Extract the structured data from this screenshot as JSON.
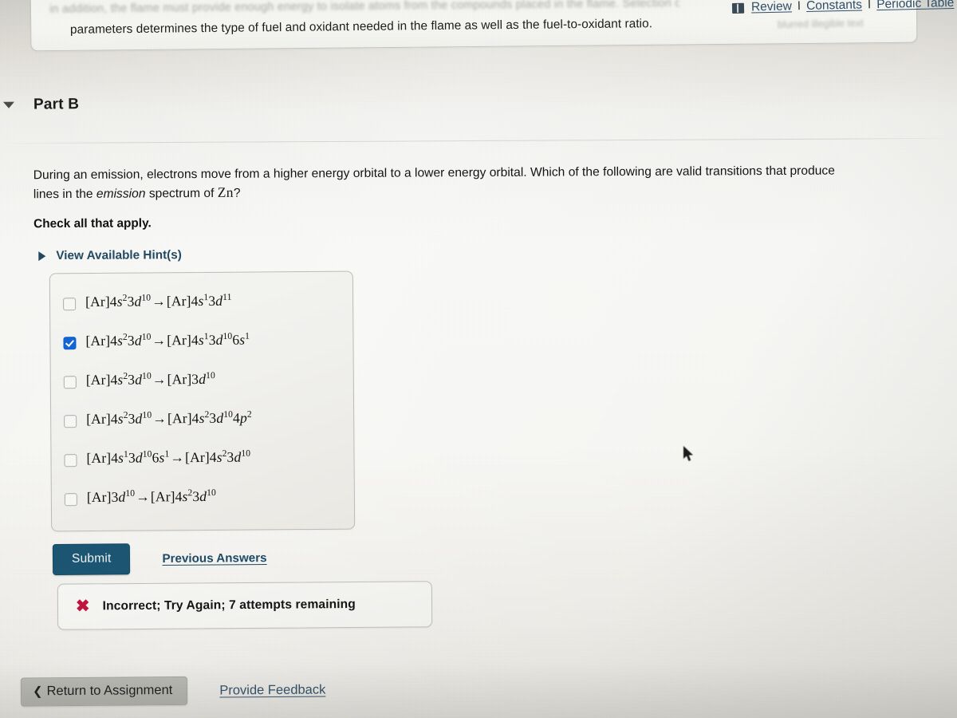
{
  "top_banner": {
    "ghost_line": "in addition, the flame must provide enough energy to isolate atoms from the compounds placed in the flame. Selection of",
    "visible_line": "parameters determines the type of fuel and oxidant needed in the flame as well as the fuel-to-oxidant ratio.",
    "ghost_right": "blurred illegible text"
  },
  "top_links": {
    "review_icon": "review-book-icon",
    "review": "Review",
    "separator": "I",
    "constants": "Constants",
    "periodic_table": "Periodic Table"
  },
  "part": {
    "collapse_icon": "caret-down-icon",
    "title": "Part B"
  },
  "question": {
    "line1": "During an emission, electrons move from a higher energy orbital to a lower energy orbital. Which of the following are valid transitions that produce",
    "line2_pre": "lines in the ",
    "line2_em": "emission",
    "line2_post": " spectrum of ",
    "element": "Zn",
    "line2_end": "?",
    "check_all": "Check all that apply.",
    "hint_icon": "caret-right-icon",
    "hint_label": "View Available Hint(s)"
  },
  "options": [
    {
      "checked": false,
      "text": "[Ar]4s²3d¹⁰→[Ar]4s¹3d¹¹",
      "left": {
        "core": "[Ar]4",
        "s1": "s",
        "s1sup": "2",
        "d": "3d",
        "dsup": "10"
      },
      "right": {
        "core": "[Ar]4",
        "s1": "s",
        "s1sup": "1",
        "d": "3d",
        "dsup": "11"
      }
    },
    {
      "checked": true,
      "text": "[Ar]4s²3d¹⁰→[Ar]4s¹3d¹⁰6s¹",
      "left": {
        "core": "[Ar]4",
        "s1": "s",
        "s1sup": "2",
        "d": "3d",
        "dsup": "10"
      },
      "right": {
        "core": "[Ar]4",
        "s1": "s",
        "s1sup": "1",
        "d": "3d",
        "dsup": "10",
        "extra": "6s",
        "extrasup": "1"
      }
    },
    {
      "checked": false,
      "text": "[Ar]4s²3d¹⁰→[Ar]3d¹⁰",
      "left": {
        "core": "[Ar]4",
        "s1": "s",
        "s1sup": "2",
        "d": "3d",
        "dsup": "10"
      },
      "right": {
        "core": "[Ar]",
        "d": "3d",
        "dsup": "10"
      }
    },
    {
      "checked": false,
      "text": "[Ar]4s²3d¹⁰→[Ar]4s²3d¹⁰4p²",
      "left": {
        "core": "[Ar]4",
        "s1": "s",
        "s1sup": "2",
        "d": "3d",
        "dsup": "10"
      },
      "right": {
        "core": "[Ar]4",
        "s1": "s",
        "s1sup": "2",
        "d": "3d",
        "dsup": "10",
        "extra": "4p",
        "extrasup": "2"
      }
    },
    {
      "checked": false,
      "text": "[Ar]4s¹3d¹⁰6s¹→[Ar]4s²3d¹⁰",
      "left": {
        "core": "[Ar]4",
        "s1": "s",
        "s1sup": "1",
        "d": "3d",
        "dsup": "10",
        "extra": "6s",
        "extrasup": "1"
      },
      "right": {
        "core": "[Ar]4",
        "s1": "s",
        "s1sup": "2",
        "d": "3d",
        "dsup": "10"
      }
    },
    {
      "checked": false,
      "text": "[Ar]3d¹⁰→[Ar]4s²3d¹⁰",
      "left": {
        "core": "[Ar]",
        "d": "3d",
        "dsup": "10"
      },
      "right": {
        "core": "[Ar]4",
        "s1": "s",
        "s1sup": "2",
        "d": "3d",
        "dsup": "10"
      }
    }
  ],
  "actions": {
    "submit_label": "Submit",
    "previous_answers_label": "Previous Answers"
  },
  "feedback": {
    "icon": "x-mark-icon",
    "message": "Incorrect; Try Again; 7 attempts remaining",
    "icon_color": "#c2143c"
  },
  "bottom": {
    "back_chevron": "chevron-left-icon",
    "return_label": "Return to Assignment",
    "provide_feedback_label": "Provide Feedback"
  },
  "cursor": {
    "icon": "mouse-arrow-cursor"
  },
  "colors": {
    "submit_bg": "#1b5673",
    "link": "#2b4a63",
    "checkbox_checked": "#1166d8",
    "page_bg": "#f4f4f1"
  }
}
